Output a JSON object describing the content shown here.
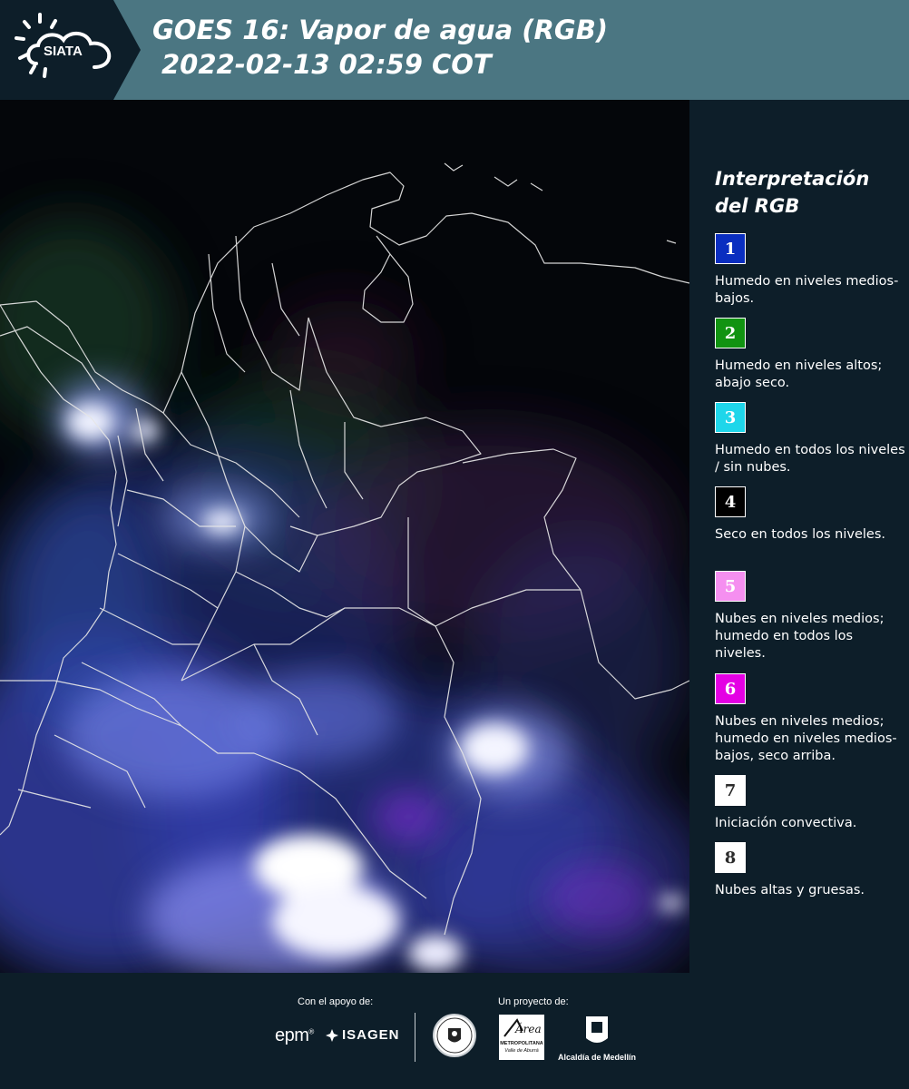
{
  "header": {
    "logo_text": "SIATA",
    "title_line1": "GOES 16: Vapor de agua (RGB)",
    "title_line2": "2022-02-13 02:59 COT"
  },
  "map": {
    "icon": "satellite-water-vapor-map",
    "content": "Colombia y países vecinos con límites departamentales"
  },
  "legend": {
    "title_line1": "Interpretación",
    "title_line2": "del RGB",
    "items": [
      {
        "number": "1",
        "color": "#0a2ec0",
        "text_color": "#ffffff",
        "description": "Humedo en niveles medios-bajos."
      },
      {
        "number": "2",
        "color": "#119311",
        "text_color": "#ffffff",
        "description": "Humedo en niveles altos; abajo seco."
      },
      {
        "number": "3",
        "color": "#1ed6ea",
        "text_color": "#ffffff",
        "description": "Humedo en todos los niveles / sin nubes."
      },
      {
        "number": "4",
        "color": "#000000",
        "text_color": "#ffffff",
        "description": "Seco en todos los niveles."
      },
      {
        "number": "5",
        "color": "#f58ff0",
        "text_color": "#ffffff",
        "description": "Nubes en niveles medios; humedo en todos los niveles."
      },
      {
        "number": "6",
        "color": "#e400e4",
        "text_color": "#ffffff",
        "description": "Nubes en niveles medios; humedo en niveles medios-bajos, seco arriba."
      },
      {
        "number": "7",
        "color": "#ffffff",
        "text_color": "#2b2b2b",
        "description": "Iniciación convectiva."
      },
      {
        "number": "8",
        "color": "#ffffff",
        "text_color": "#2b2b2b",
        "description": "Nubes altas y gruesas."
      }
    ]
  },
  "footer": {
    "support_label": "Con el apoyo de:",
    "project_label": "Un proyecto de:",
    "sponsors": [
      "epm",
      "ISAGEN"
    ],
    "epm_mark": "®",
    "amva_line1": "METROPOLITANA",
    "amva_line2": "Valle de Aburrá",
    "amva_script": "Área",
    "alcaldia": "Alcaldía de Medellín"
  }
}
